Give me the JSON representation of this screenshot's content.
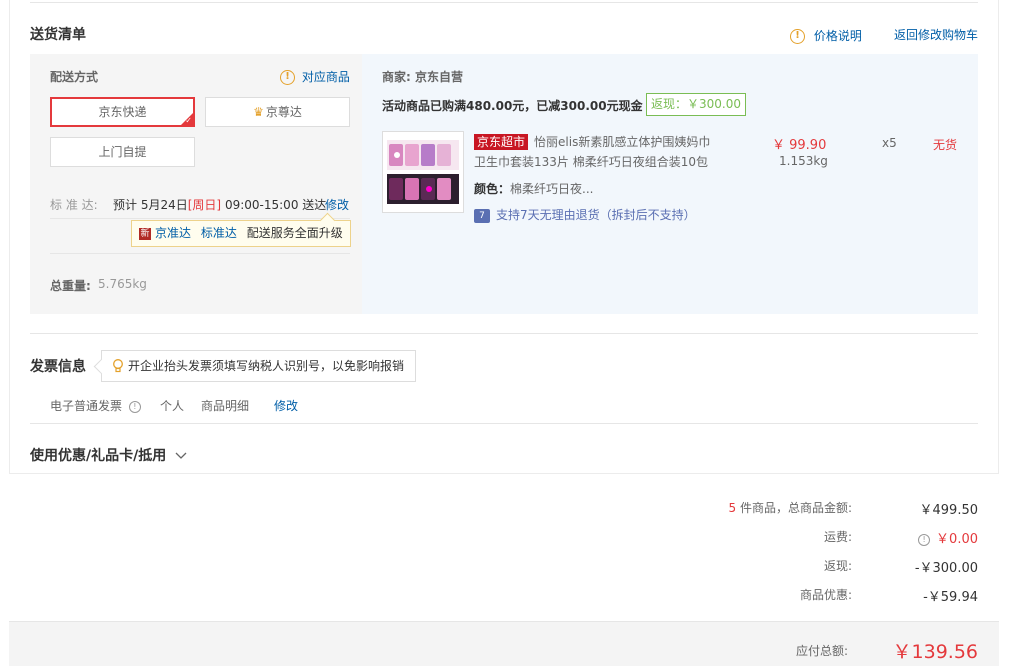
{
  "delivery_section": {
    "title": "送货清单",
    "price_note_label": "价格说明",
    "back_to_cart_label": "返回修改购物车"
  },
  "shipping": {
    "method_title": "配送方式",
    "match_goods_label": "对应商品",
    "options": [
      "京东快递",
      "京尊达",
      "上门自提"
    ],
    "schedule_label": "标 准 达:",
    "schedule_prefix": "预计",
    "schedule_date": "5月24日",
    "schedule_weekday": "[周日]",
    "schedule_time": "09:00-15:00 送达",
    "modify_label": "修改",
    "tooltip": {
      "badge": "新",
      "link1": "京准达",
      "link2": "标准达",
      "text": "配送服务全面升级"
    },
    "total_weight_label": "总重量:",
    "total_weight_value": "5.765kg"
  },
  "goods": {
    "merchant_label": "商家:",
    "merchant_name": "京东自营",
    "promo_text": "活动商品已购满480.00元，已减300.00元现金",
    "rebate_tag": "返现：￥300.00",
    "item": {
      "market_tag": "京东超市",
      "name_line1": "怡丽elis新素肌感立体护围姨妈巾",
      "name_line2": "卫生巾套装133片 棉柔纤巧日夜组合装10包",
      "color_label": "颜色：",
      "color_value": "棉柔纤巧日夜...",
      "price": "￥ 99.90",
      "weight": "1.153kg",
      "quantity": "x5",
      "stock_status": "无货",
      "return_badge": "7",
      "return_policy": "支持7天无理由退货（拆封后不支持）"
    }
  },
  "invoice": {
    "title": "发票信息",
    "tip": "开企业抬头发票须填写纳税人识别号，以免影响报销",
    "type": "电子普通发票",
    "person": "个人",
    "detail": "商品明细",
    "modify_label": "修改"
  },
  "coupon": {
    "title": "使用优惠/礼品卡/抵用"
  },
  "summary": {
    "item_count": "5",
    "item_count_suffix": "件商品，总商品金额:",
    "goods_amount": "￥499.50",
    "shipping_label": "运费:",
    "shipping_value": "￥0.00",
    "rebate_label": "返现:",
    "rebate_value": "-￥300.00",
    "discount_label": "商品优惠:",
    "discount_value": "-￥59.94",
    "payable_label": "应付总额:",
    "payable_value": "￥139.56"
  },
  "colors": {
    "accent_red": "#e4393c",
    "link_blue": "#005ea7",
    "warn_orange": "#e4a12b",
    "rebate_green": "#7abd54",
    "goods_bg": "#f2f7fc"
  }
}
